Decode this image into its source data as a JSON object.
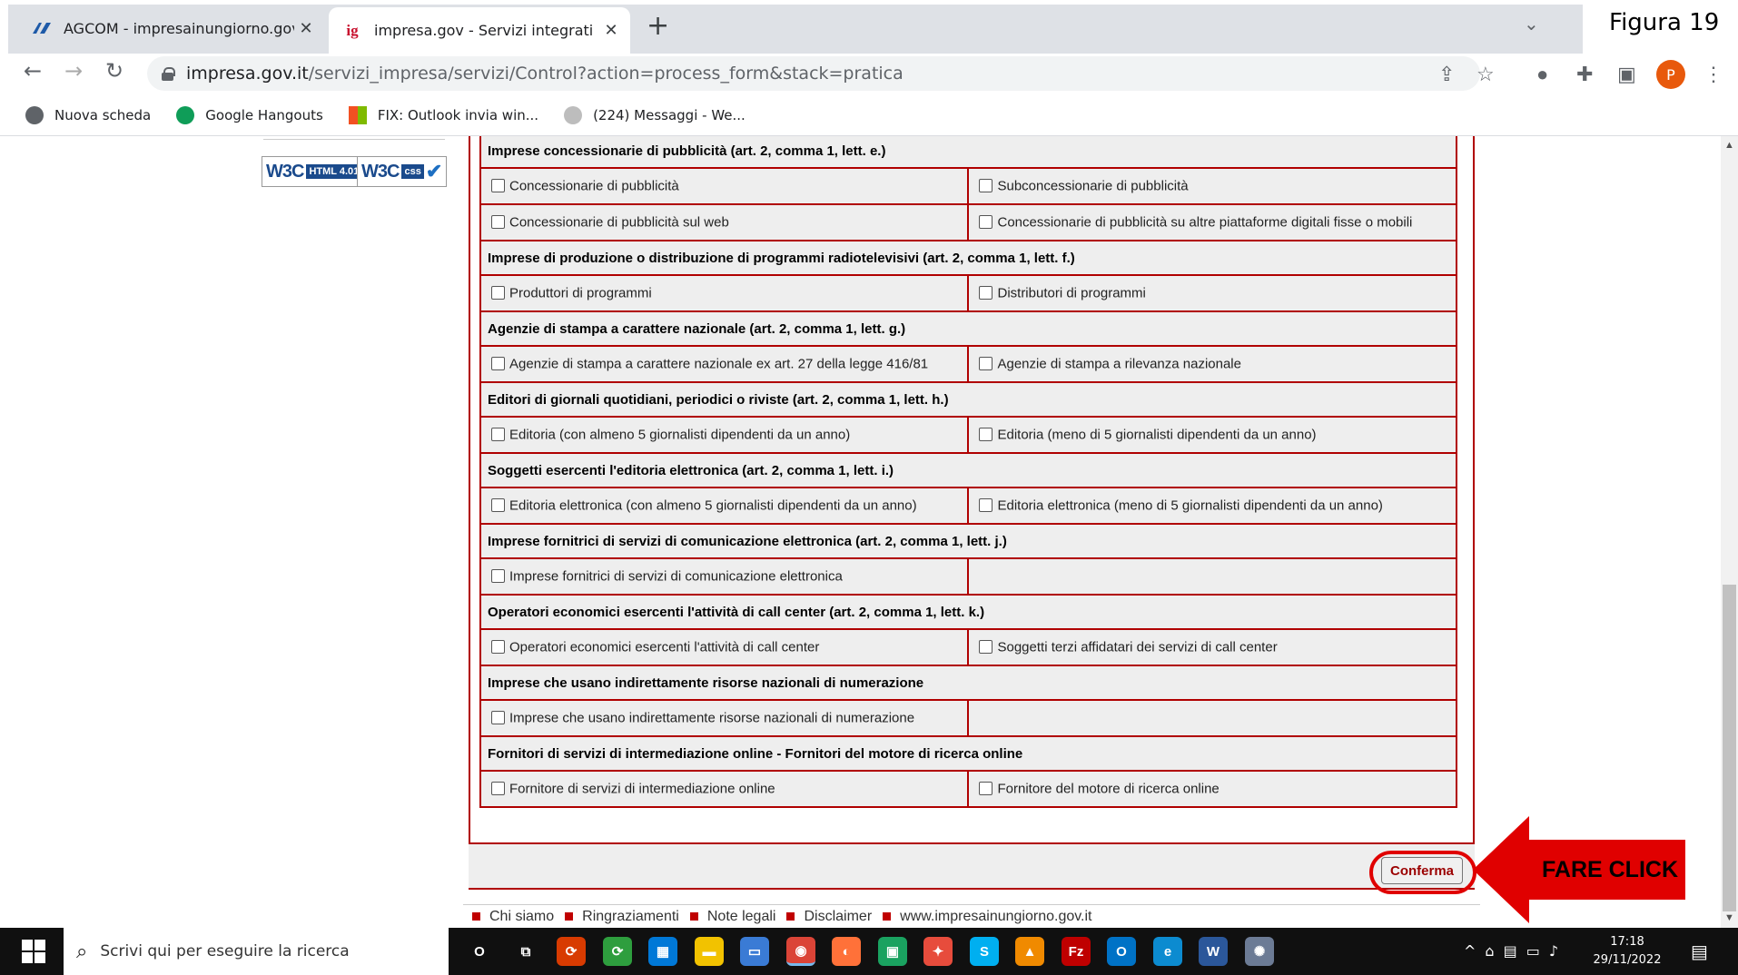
{
  "browser": {
    "tabs": [
      {
        "title": "AGCOM - impresainungiorno.gov.it",
        "favicon": "agcom-logo-icon",
        "active": false
      },
      {
        "title": "impresa.gov - Servizi integrati",
        "favicon_text": "ig",
        "active": true
      }
    ],
    "new_tab_glyph": "+",
    "close_glyph": "✕",
    "figure_label": "Figura 19",
    "url_host": "impresa.gov.it",
    "url_path": "/servizi_impresa/servizi/Control?action=process_form&stack=pratica",
    "profile_initial": "P",
    "bookmarks": [
      {
        "label": "Nuova scheda",
        "icon": "globe-icon",
        "color": "#5f6368"
      },
      {
        "label": "Google Hangouts",
        "icon": "hangouts-icon",
        "color": "#0f9d58"
      },
      {
        "label": "FIX: Outlook invia win...",
        "icon": "windows-logo-icon",
        "color": "#f25022"
      },
      {
        "label": "(224) Messaggi - We...",
        "icon": "messages-icon",
        "color": "#bdbdbd"
      }
    ]
  },
  "page": {
    "badges": [
      {
        "w3c": "W3C",
        "tag": "HTML 4.01"
      },
      {
        "w3c": "W3C",
        "tag": "css"
      }
    ],
    "sections": [
      {
        "header": "Imprese concessionarie di pubblicità (art. 2, comma 1, lett. e.)",
        "rows": [
          [
            "Concessionarie di pubblicità",
            "Subconcessionarie di pubblicità"
          ],
          [
            "Concessionarie di pubblicità sul web",
            "Concessionarie di pubblicità su altre piattaforme digitali fisse o mobili"
          ]
        ]
      },
      {
        "header": "Imprese di produzione o distribuzione di programmi radiotelevisivi (art. 2, comma 1, lett. f.)",
        "rows": [
          [
            "Produttori di programmi",
            "Distributori di programmi"
          ]
        ]
      },
      {
        "header": "Agenzie di stampa a carattere nazionale (art. 2, comma 1, lett. g.)",
        "rows": [
          [
            "Agenzie di stampa a carattere nazionale ex art. 27 della legge 416/81",
            "Agenzie di stampa a rilevanza nazionale"
          ]
        ]
      },
      {
        "header": "Editori di giornali quotidiani, periodici o riviste (art. 2, comma 1, lett. h.)",
        "rows": [
          [
            "Editoria (con almeno 5 giornalisti dipendenti da un anno)",
            "Editoria (meno di 5 giornalisti dipendenti da un anno)"
          ]
        ]
      },
      {
        "header": "Soggetti esercenti l'editoria elettronica (art. 2, comma 1, lett. i.)",
        "rows": [
          [
            "Editoria elettronica (con almeno 5 giornalisti dipendenti da un anno)",
            "Editoria elettronica (meno di 5 giornalisti dipendenti da un anno)"
          ]
        ]
      },
      {
        "header": "Imprese fornitrici di servizi di comunicazione elettronica (art. 2, comma 1, lett. j.)",
        "rows": [
          [
            "Imprese fornitrici di servizi di comunicazione elettronica",
            ""
          ]
        ]
      },
      {
        "header": "Operatori economici esercenti l'attività di call center (art. 2, comma 1, lett. k.)",
        "rows": [
          [
            "Operatori economici esercenti l'attività di call center",
            "Soggetti terzi affidatari dei servizi di call center"
          ]
        ]
      },
      {
        "header": "Imprese che usano indirettamente risorse nazionali di numerazione",
        "rows": [
          [
            "Imprese che usano indirettamente risorse nazionali di numerazione",
            ""
          ]
        ]
      },
      {
        "header": "Fornitori di servizi di intermediazione online - Fornitori del motore di ricerca online",
        "rows": [
          [
            "Fornitore di servizi di intermediazione online",
            "Fornitore del motore di ricerca online"
          ]
        ]
      }
    ],
    "confirm_label": "Conferma",
    "annotation": "FARE CLICK",
    "annotation_color": "#e00000",
    "footer_links": [
      "Chi siamo",
      "Ringraziamenti",
      "Note legali",
      "Disclaimer",
      "www.impresainungiorno.gov.it"
    ]
  },
  "taskbar": {
    "search_placeholder": "Scrivi qui per eseguire la ricerca",
    "apps": [
      {
        "name": "cortana-icon",
        "glyph": "O",
        "color": "transparent"
      },
      {
        "name": "task-view-icon",
        "glyph": "⧉",
        "color": "transparent"
      },
      {
        "name": "sync-red-icon",
        "glyph": "⟳",
        "color": "#d83b01"
      },
      {
        "name": "sync-green-icon",
        "glyph": "⟳",
        "color": "#2e9e3e"
      },
      {
        "name": "calculator-icon",
        "glyph": "▦",
        "color": "#0078d7"
      },
      {
        "name": "file-explorer-icon",
        "glyph": "▬",
        "color": "#f2c200"
      },
      {
        "name": "remote-desktop-icon",
        "glyph": "▭",
        "color": "#3a7bd5"
      },
      {
        "name": "chrome-icon",
        "glyph": "◉",
        "color": "#db4437"
      },
      {
        "name": "firefox-icon",
        "glyph": "◐",
        "color": "#ff7139"
      },
      {
        "name": "maps-app-icon",
        "glyph": "▣",
        "color": "#1aa260"
      },
      {
        "name": "cleaner-icon",
        "glyph": "✦",
        "color": "#e74c3c"
      },
      {
        "name": "skype-icon",
        "glyph": "S",
        "color": "#00aff0"
      },
      {
        "name": "vlc-icon",
        "glyph": "▲",
        "color": "#f08a00"
      },
      {
        "name": "filezilla-icon",
        "glyph": "Fz",
        "color": "#bf0000"
      },
      {
        "name": "outlook-icon",
        "glyph": "O",
        "color": "#0072c6"
      },
      {
        "name": "edge-icon",
        "glyph": "e",
        "color": "#0c8bd0"
      },
      {
        "name": "word-icon",
        "glyph": "W",
        "color": "#2b579a"
      },
      {
        "name": "seal-app-icon",
        "glyph": "✺",
        "color": "#6c7b95"
      }
    ],
    "tray_glyphs": [
      "^",
      "⌂",
      "▤",
      "▭",
      "♪"
    ],
    "time": "17:18",
    "date": "29/11/2022"
  }
}
